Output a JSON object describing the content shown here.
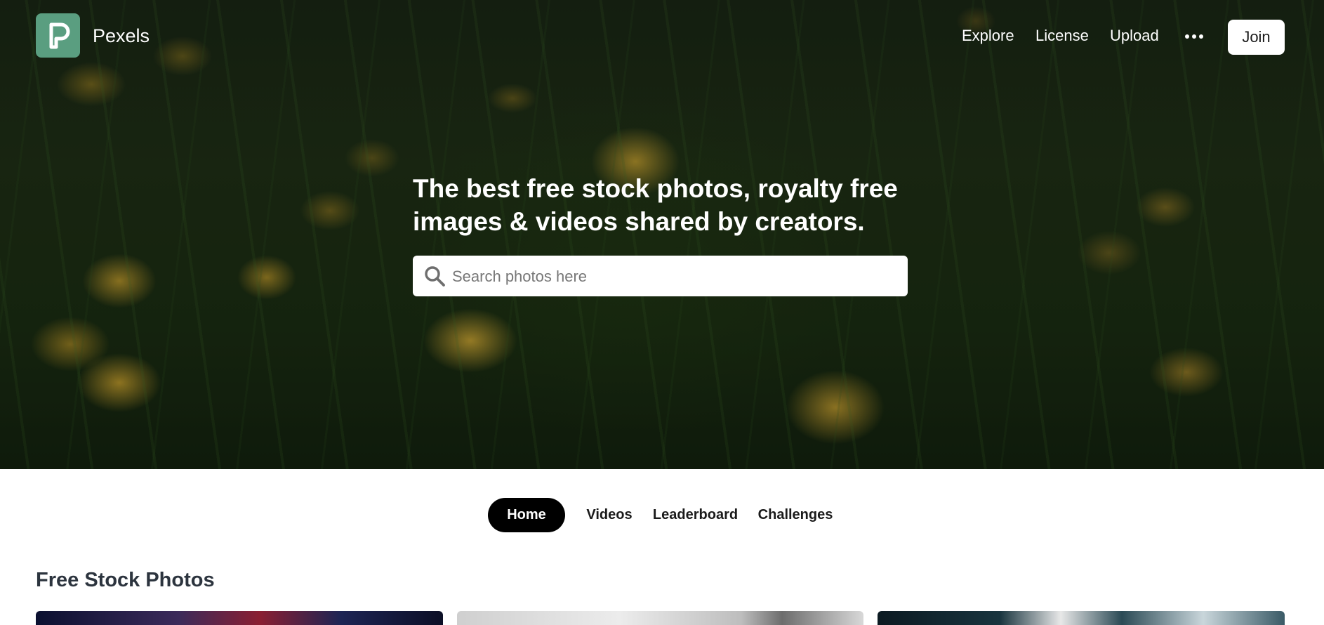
{
  "header": {
    "brand": "Pexels",
    "logo_icon": "pexels-logo-icon",
    "nav": [
      "Explore",
      "License",
      "Upload"
    ],
    "more_icon": "more-dots-icon",
    "join_label": "Join"
  },
  "hero": {
    "title_line1": "The best free stock photos, royalty free",
    "title_line2": "images & videos shared by creators.",
    "search": {
      "placeholder": "Search photos here",
      "icon": "search-icon"
    }
  },
  "tabs": [
    {
      "label": "Home",
      "active": true
    },
    {
      "label": "Videos",
      "active": false
    },
    {
      "label": "Leaderboard",
      "active": false
    },
    {
      "label": "Challenges",
      "active": false
    }
  ],
  "main": {
    "section_title": "Free Stock Photos"
  },
  "colors": {
    "brand": "#5a9e80",
    "active_tab": "#000000"
  }
}
